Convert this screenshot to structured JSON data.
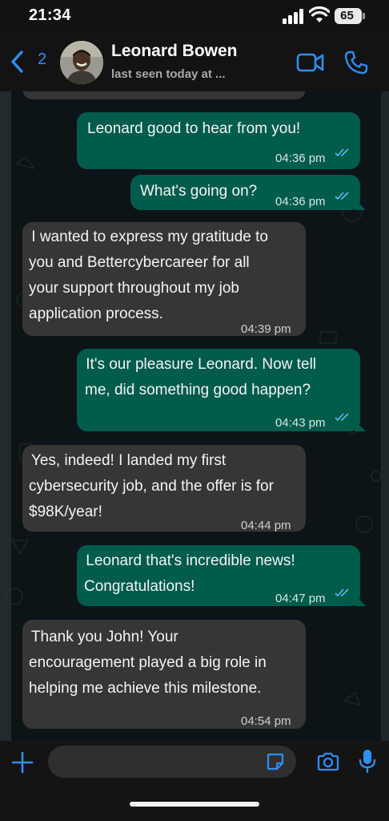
{
  "status_bar": {
    "time": "21:34",
    "battery": "65"
  },
  "header": {
    "back_count": "2",
    "contact_name": "Leonard Bowen",
    "contact_status": "last seen today at ..."
  },
  "messages": [
    {
      "direction": "in",
      "text": "",
      "time": "",
      "partial": true
    },
    {
      "direction": "out",
      "text": "Leonard good to hear from you!",
      "time": "04:36 pm",
      "read": true
    },
    {
      "direction": "out",
      "text": "What's going on?",
      "time": "04:36 pm",
      "read": true
    },
    {
      "direction": "in",
      "lines": [
        " I wanted to express my gratitude to",
        "you and Bettercybercareer for all",
        "your support throughout my job",
        "application process."
      ],
      "time": "04:39 pm"
    },
    {
      "direction": "out",
      "lines": [
        " It's our pleasure Leonard. Now tell",
        "me, did something good happen?"
      ],
      "time": "04:43 pm",
      "read": true
    },
    {
      "direction": "in",
      "lines": [
        " Yes, indeed! I landed my first",
        "cybersecurity job, and the offer is for",
        "$98K/year!"
      ],
      "time": "04:44 pm"
    },
    {
      "direction": "out",
      "lines": [
        " Leonard that's incredible news!",
        "Congratulations!"
      ],
      "time": "04:47 pm",
      "read": true
    },
    {
      "direction": "in",
      "lines": [
        " Thank you John! Your",
        "encouragement played a big role in",
        "helping me achieve this milestone."
      ],
      "time": "04:54 pm"
    }
  ],
  "input": {
    "placeholder": ""
  },
  "colors": {
    "accent": "#2e8ff0",
    "outgoing_bubble": "#005c4b",
    "incoming_bubble": "#363636",
    "read_ticks": "#53bdeb"
  },
  "icons": {
    "back": "chevron-left-icon",
    "video": "video-camera-icon",
    "call": "phone-icon",
    "attach": "plus-icon",
    "sticker": "sticker-icon",
    "camera": "camera-icon",
    "mic": "microphone-icon"
  }
}
